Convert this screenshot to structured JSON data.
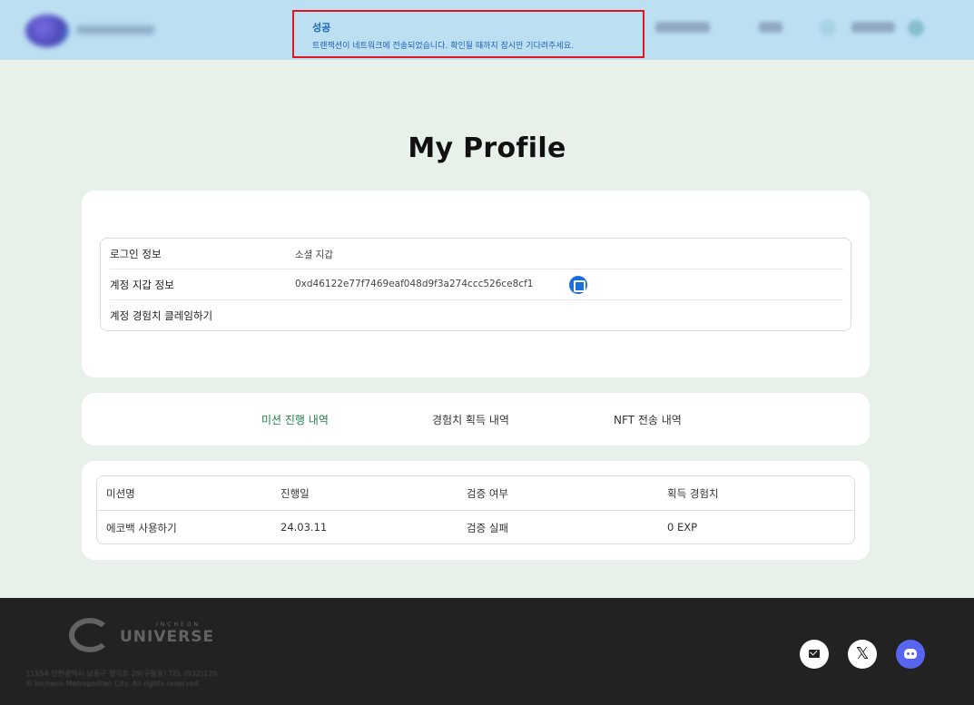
{
  "toast": {
    "title": "성공",
    "message": "트랜잭션이 네트워크에 전송되었습니다. 확인될 때까지 잠시만 기다려주세요."
  },
  "page": {
    "title": "My Profile"
  },
  "profile": {
    "login_label": "로그인 정보",
    "login_value": "소셜 지갑",
    "wallet_label": "계정 지갑 정보",
    "wallet_value": "0xd46122e77f7469eaf048d9f3a274ccc526ce8cf1",
    "claim_label": "계정 경험치 클레임하기"
  },
  "tabs": [
    {
      "label": "미션 진행 내역",
      "active": true
    },
    {
      "label": "경험치 획득 내역",
      "active": false
    },
    {
      "label": "NFT 전송 내역",
      "active": false
    }
  ],
  "table": {
    "headers": [
      "미션명",
      "진행일",
      "검증 여부",
      "획득 경험치"
    ],
    "rows": [
      [
        "에코백 사용하기",
        "24.03.11",
        "검증 실패",
        "0 EXP"
      ]
    ]
  },
  "footer": {
    "brand_small": "INCHEON",
    "brand_big": "UNIVERSE",
    "address": "21554 인천광역시 남동구 정각로 29(구월동) TEL (032)120",
    "copyright": "© Incheon Metropolitan City. All rights reserved."
  },
  "icons": {
    "copy": "copy-icon",
    "mail": "mail-icon",
    "x": "x-icon",
    "discord": "discord-icon"
  },
  "colors": {
    "header_bg": "#bcdff2",
    "page_bg": "#e8f0ea",
    "toast_border": "#e1141f",
    "toast_text": "#1565c0",
    "active_tab": "#1e7d4b",
    "footer_bg": "#222222",
    "discord": "#5865f2"
  }
}
